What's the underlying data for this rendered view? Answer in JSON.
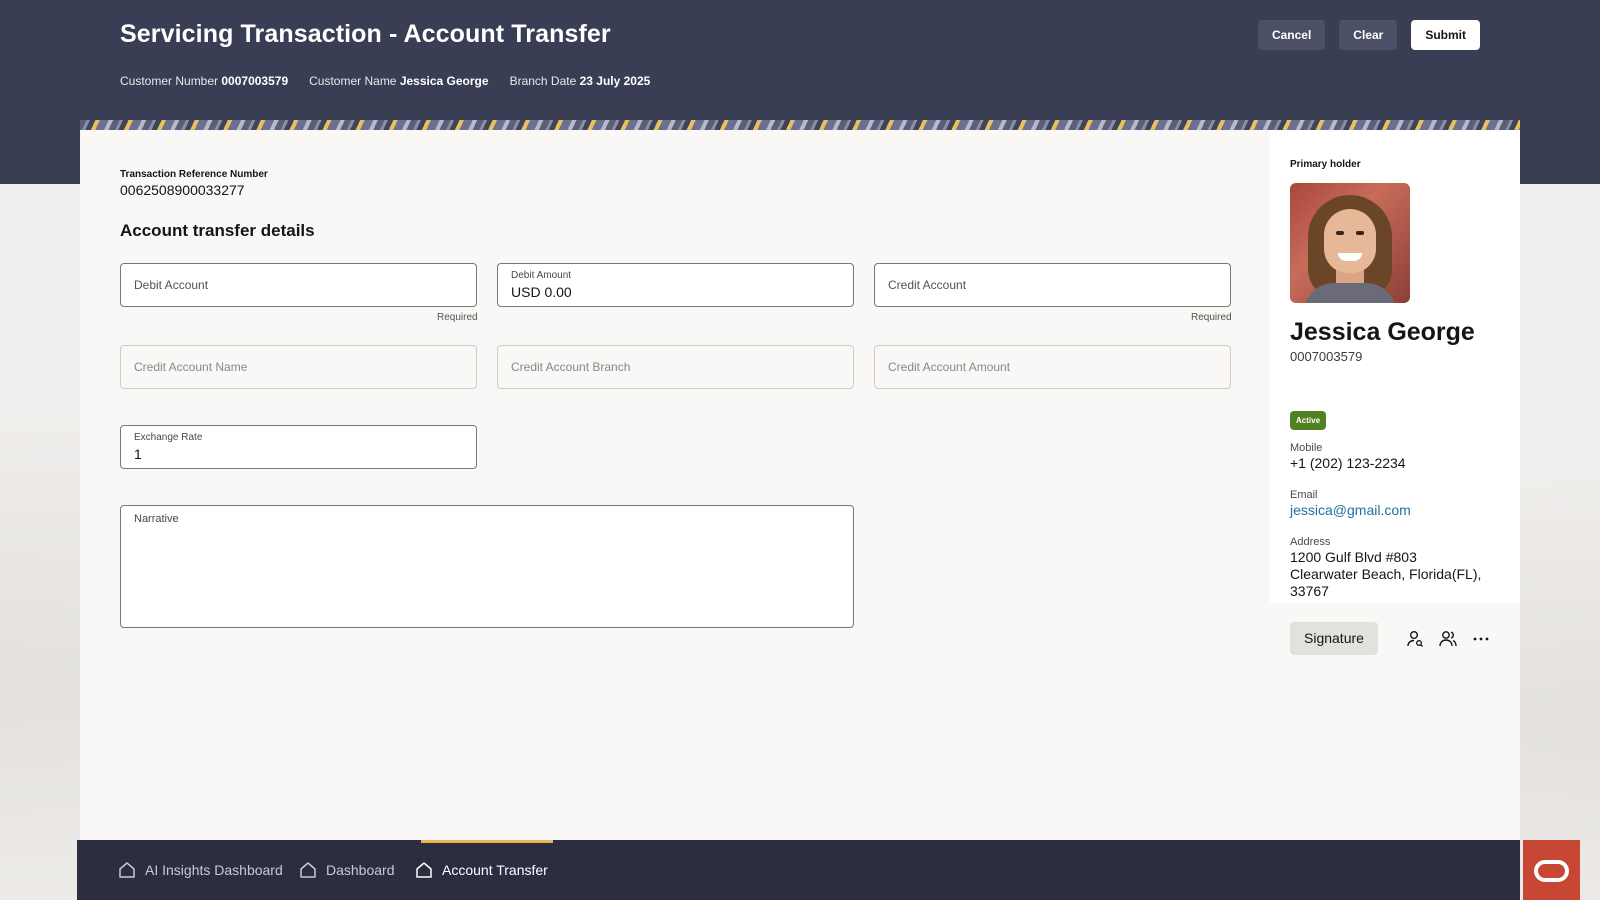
{
  "header": {
    "title": "Servicing Transaction - Account Transfer",
    "customer_number_label": "Customer Number",
    "customer_number": "0007003579",
    "customer_name_label": "Customer Name",
    "customer_name": "Jessica George",
    "branch_date_label": "Branch Date",
    "branch_date": "23 July 2025",
    "buttons": {
      "cancel": "Cancel",
      "clear": "Clear",
      "submit": "Submit"
    }
  },
  "form": {
    "reference_label": "Transaction Reference Number",
    "reference_value": "0062508900033277",
    "section_title": "Account transfer details",
    "debit_account": {
      "placeholder": "Debit Account",
      "hint": "Required"
    },
    "debit_amount": {
      "label": "Debit Amount",
      "value": "USD 0.00"
    },
    "credit_account": {
      "placeholder": "Credit Account",
      "hint": "Required"
    },
    "credit_account_name": {
      "placeholder": "Credit Account Name"
    },
    "credit_account_branch": {
      "placeholder": "Credit Account Branch"
    },
    "credit_account_amount": {
      "placeholder": "Credit Account Amount"
    },
    "exchange_rate": {
      "label": "Exchange Rate",
      "value": "1"
    },
    "narrative": {
      "placeholder": "Narrative"
    }
  },
  "holder": {
    "label": "Primary holder",
    "name": "Jessica George",
    "number": "0007003579",
    "status": "Active",
    "status_color": "#508223",
    "mobile_label": "Mobile",
    "mobile": "+1 (202) 123-2234",
    "email_label": "Email",
    "email": "jessica@gmail.com",
    "address_label": "Address",
    "address_line1": "1200 Gulf Blvd #803",
    "address_line2": "Clearwater Beach, Florida(FL),",
    "address_line3": "33767",
    "signature_button": "Signature",
    "icons": [
      "person-search-icon",
      "people-icon",
      "more-icon"
    ]
  },
  "bottom_nav": {
    "items": [
      {
        "label": "AI Insights Dashboard",
        "icon": "home-icon"
      },
      {
        "label": "Dashboard",
        "icon": "home-icon"
      },
      {
        "label": "Account Transfer",
        "icon": "home-icon",
        "active": true
      }
    ],
    "accent_color": "#e8b64b"
  },
  "brand": {
    "logo": "oracle-logo",
    "color": "#c74634"
  }
}
